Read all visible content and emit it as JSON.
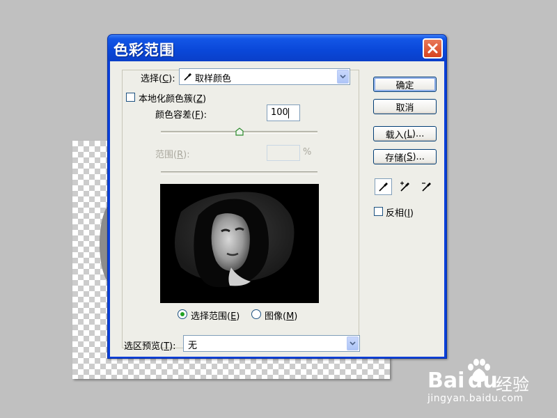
{
  "dialog": {
    "title": "色彩范围",
    "select_label_pre": "选择(",
    "select_label_key": "C",
    "select_label_post": "):",
    "select_value": "取样颜色",
    "localized_label_pre": "本地化颜色簇(",
    "localized_label_key": "Z",
    "localized_label_post": ")",
    "fuzziness_label_pre": "颜色容差(",
    "fuzziness_label_key": "F",
    "fuzziness_label_post": "):",
    "fuzziness_value": "100",
    "fuzziness_slider_level": 0.5,
    "range_label_pre": "范围(",
    "range_label_key": "R",
    "range_label_post": "):",
    "range_unit": "%",
    "radio_selection_pre": "选择范围(",
    "radio_selection_key": "E",
    "radio_selection_post": ")",
    "radio_image_pre": "图像(",
    "radio_image_key": "M",
    "radio_image_post": ")",
    "preview_label_pre": "选区预览(",
    "preview_label_key": "T",
    "preview_label_post": "):",
    "preview_value": "无",
    "invert_label_pre": "反相(",
    "invert_label_key": "I",
    "invert_label_post": ")"
  },
  "buttons": {
    "ok": "确定",
    "cancel": "取消",
    "load_pre": "载入(",
    "load_key": "L",
    "load_post": ")...",
    "save_pre": "存储(",
    "save_key": "S",
    "save_post": ")..."
  },
  "watermark": {
    "brand_a": "Bai",
    "brand_b": "du",
    "brand_cn": "经验",
    "url": "jingyan.baidu.com"
  },
  "colors": {
    "titlebar": "#0a47d8",
    "client": "#eeeee8",
    "radio_selected": "#21a121"
  }
}
